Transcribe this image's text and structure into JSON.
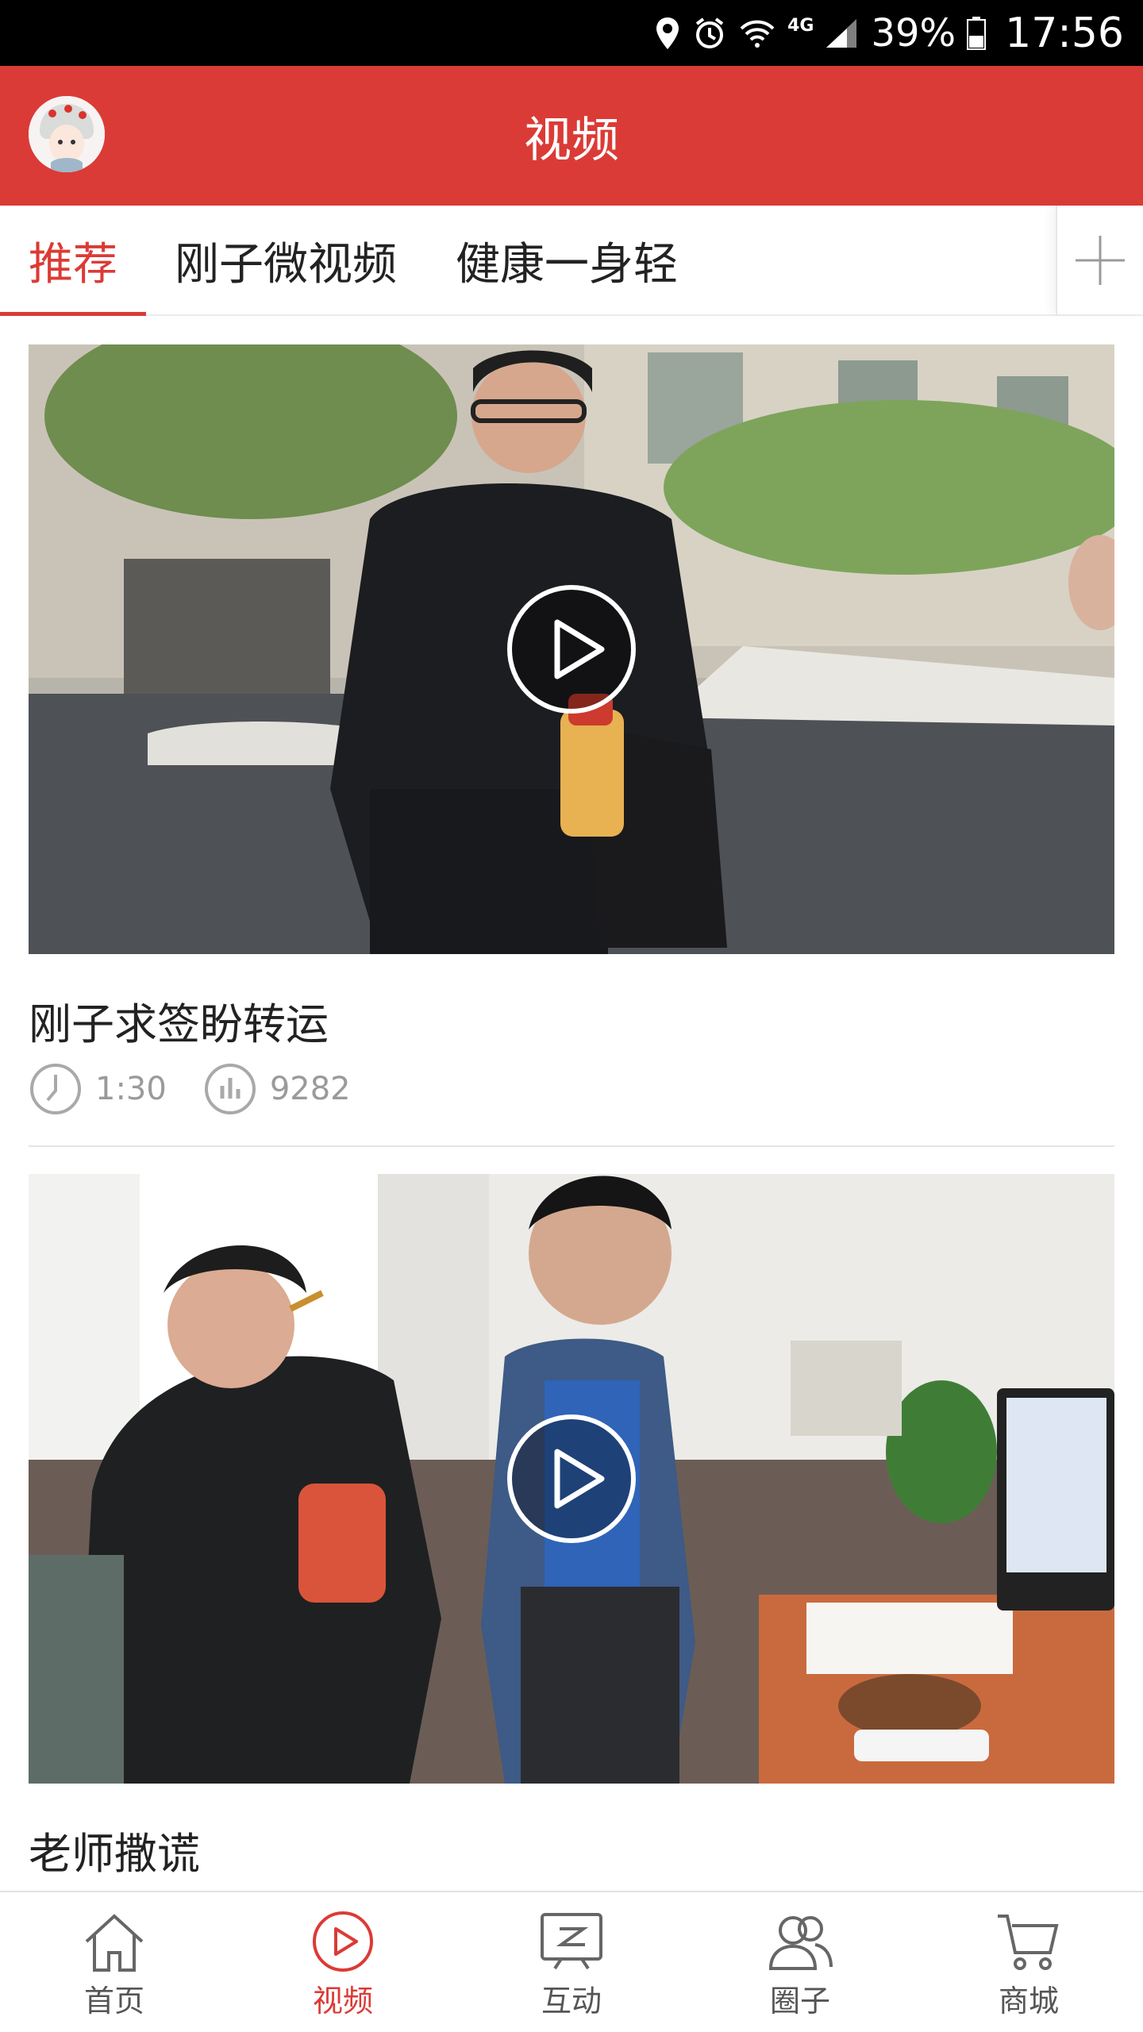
{
  "status_bar": {
    "network": "4G",
    "battery": "39%",
    "time": "17:56"
  },
  "header": {
    "title": "视频"
  },
  "tabs": [
    {
      "label": "推荐",
      "active": true
    },
    {
      "label": "刚子微视频",
      "active": false
    },
    {
      "label": "健康一身轻",
      "active": false
    }
  ],
  "videos": [
    {
      "title": "刚子求签盼转运",
      "duration": "1:30",
      "views": "9282"
    },
    {
      "title": "老师撒谎"
    }
  ],
  "bottom_nav": [
    {
      "label": "首页",
      "icon": "home-icon",
      "active": false
    },
    {
      "label": "视频",
      "icon": "video-play-icon",
      "active": true
    },
    {
      "label": "互动",
      "icon": "interact-icon",
      "active": false
    },
    {
      "label": "圈子",
      "icon": "circle-users-icon",
      "active": false
    },
    {
      "label": "商城",
      "icon": "cart-icon",
      "active": false
    }
  ],
  "colors": {
    "accent": "#db3b36",
    "status_bar": "#000000",
    "meta_text": "#9a9a9a"
  }
}
